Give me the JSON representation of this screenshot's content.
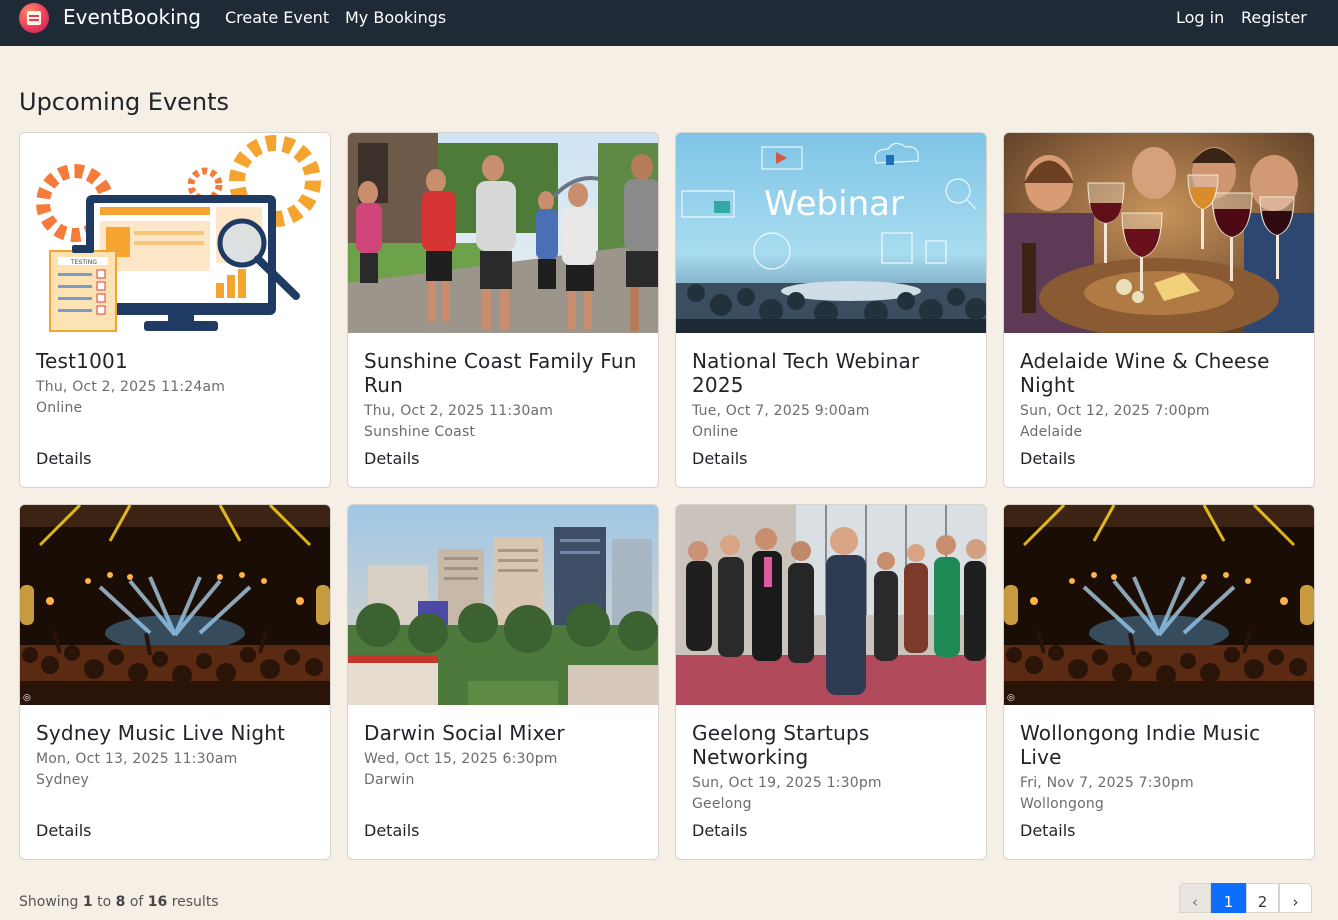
{
  "app": {
    "brand": "EventBooking"
  },
  "nav": {
    "create_event": "Create Event",
    "my_bookings": "My Bookings",
    "login": "Log in",
    "register": "Register"
  },
  "page": {
    "title": "Upcoming Events"
  },
  "events": [
    {
      "title": "Test1001",
      "date": "Thu, Oct 2, 2025 11:24am",
      "location": "Online",
      "details": "Details",
      "image": "testing-illustration"
    },
    {
      "title": "Sunshine Coast Family Fun Run",
      "date": "Thu, Oct 2, 2025 11:30am",
      "location": "Sunshine Coast",
      "details": "Details",
      "image": "runners-photo"
    },
    {
      "title": "National Tech Webinar 2025",
      "date": "Tue, Oct 7, 2025 9:00am",
      "location": "Online",
      "details": "Details",
      "image": "webinar-photo",
      "image_text": "Webinar"
    },
    {
      "title": "Adelaide Wine & Cheese Night",
      "date": "Sun, Oct 12, 2025 7:00pm",
      "location": "Adelaide",
      "details": "Details",
      "image": "wine-photo"
    },
    {
      "title": "Sydney Music Live Night",
      "date": "Mon, Oct 13, 2025 11:30am",
      "location": "Sydney",
      "details": "Details",
      "image": "concert-photo"
    },
    {
      "title": "Darwin Social Mixer",
      "date": "Wed, Oct 15, 2025 6:30pm",
      "location": "Darwin",
      "details": "Details",
      "image": "city-photo"
    },
    {
      "title": "Geelong Startups Networking",
      "date": "Sun, Oct 19, 2025 1:30pm",
      "location": "Geelong",
      "details": "Details",
      "image": "networking-photo"
    },
    {
      "title": "Wollongong Indie Music Live",
      "date": "Fri, Nov 7, 2025 7:30pm",
      "location": "Wollongong",
      "details": "Details",
      "image": "concert-photo"
    }
  ],
  "pagination": {
    "showing_prefix": "Showing",
    "from": "1",
    "to_word": "to",
    "to": "8",
    "of_word": "of",
    "total": "16",
    "results_word": "results",
    "prev": "‹",
    "next": "›",
    "pages": [
      "1",
      "2"
    ],
    "active_page": "1"
  },
  "colors": {
    "navbar": "#1e2a36",
    "background": "#f5efe6",
    "accent": "#0d6efd"
  }
}
